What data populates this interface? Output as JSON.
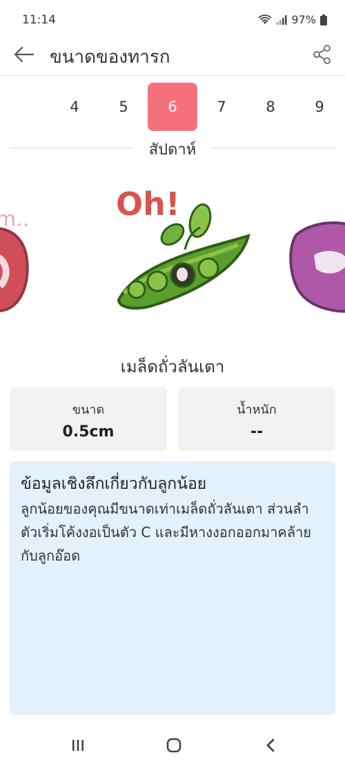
{
  "status_bar": {
    "time": "11:14",
    "battery": "97%"
  },
  "app_bar": {
    "title": "ขนาดของทารก"
  },
  "weeks": {
    "items": [
      "4",
      "5",
      "6",
      "7",
      "8",
      "9"
    ],
    "selected": "6",
    "label": "สัปดาห์"
  },
  "hero": {
    "center_caption": "Oh!",
    "left_caption": "m..",
    "center_icon": "pea-pod-embryo-illustration",
    "left_icon": "red-fruit-illustration",
    "right_icon": "purple-fruit-illustration"
  },
  "fruit_name": "เมล็ดถั่วลันเตา",
  "stats": {
    "size_label": "ขนาด",
    "size_value": "0.5cm",
    "weight_label": "น้ำหนัก",
    "weight_value": "--"
  },
  "info": {
    "title": "ข้อมูลเชิงลึกเกี่ยวกับลูกน้อย",
    "body": "ลูกน้อยของคุณมีขนาดเท่าเมล็ดถั่วลันเตา ส่วนลำตัวเริ่มโค้งงอเป็นตัว C และมีหางงอกออกมาคล้ายกับลูกอ๊อด"
  },
  "colors": {
    "accent": "#f7717c",
    "card_bg": "#f2f2f4",
    "info_bg": "#e4f0fc"
  },
  "nav": {
    "recent_icon": "recent-apps-icon",
    "home_icon": "home-icon",
    "back_icon": "back-icon"
  }
}
